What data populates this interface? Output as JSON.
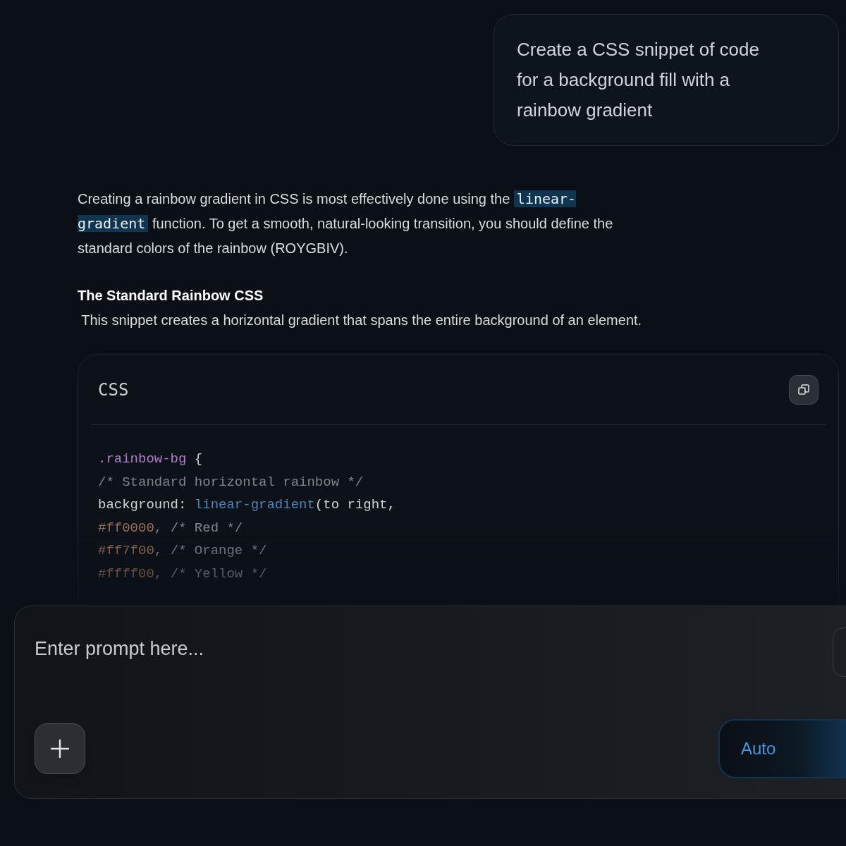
{
  "user_message": {
    "text": "Create a CSS snippet of code for a background fill with a rainbow gradient"
  },
  "answer": {
    "intro": [
      {
        "kind": "text",
        "text": "Creating a rainbow gradient in CSS is most effectively done using the "
      },
      {
        "kind": "code",
        "text": "linear-gradient"
      },
      {
        "kind": "text",
        "text": " function. To get a smooth, natural-looking transition, you should define the standard colors of the rainbow (ROYGBIV)."
      }
    ],
    "heading": "The Standard Rainbow CSS",
    "description": " This snippet creates a horizontal gradient that spans the entire background of an element.",
    "code_block": {
      "language": "CSS",
      "lines": [
        [
          {
            "kind": "selector",
            "text": ".rainbow-bg"
          },
          {
            "kind": "plain",
            "text": " {"
          }
        ],
        [
          {
            "kind": "comment",
            "text": "/* Standard horizontal rainbow */"
          }
        ],
        [
          {
            "kind": "plain",
            "text": "background: "
          },
          {
            "kind": "function",
            "text": "linear-gradient"
          },
          {
            "kind": "plain",
            "text": "(to right,"
          }
        ],
        [
          {
            "kind": "hex",
            "text": "#ff0000"
          },
          {
            "kind": "comment",
            "text": ", /* Red */"
          }
        ],
        [
          {
            "kind": "hex",
            "text": "#ff7f00"
          },
          {
            "kind": "comment",
            "text": ", /* Orange */"
          }
        ],
        [
          {
            "kind": "hex",
            "text": "#ffff00"
          },
          {
            "kind": "comment",
            "text": ", /* Yellow */"
          }
        ]
      ]
    }
  },
  "composer": {
    "placeholder": "Enter prompt here...",
    "mode_button": "Auto"
  }
}
